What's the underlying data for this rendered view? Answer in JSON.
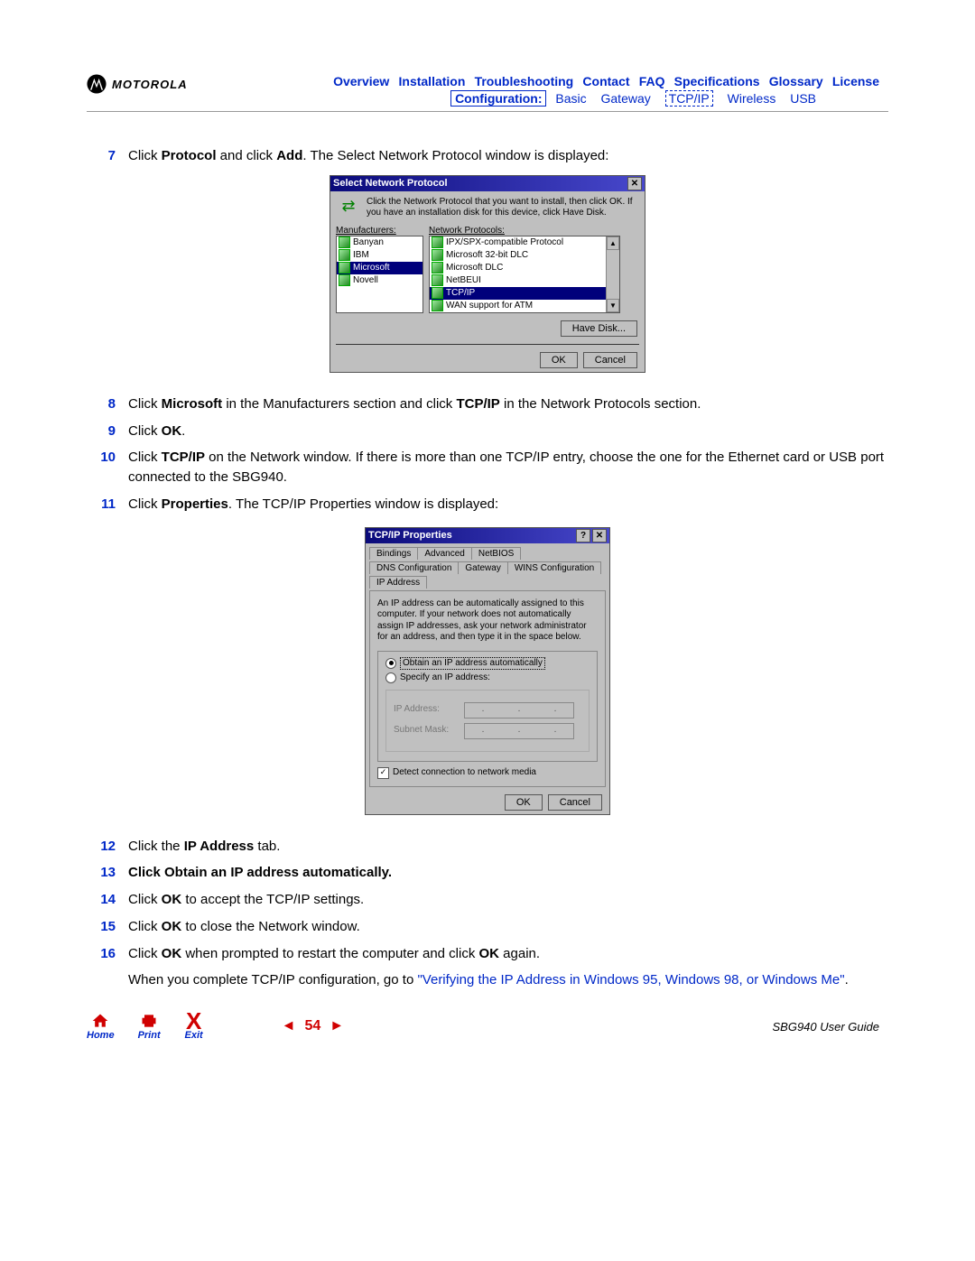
{
  "header": {
    "logo_text": "MOTOROLA",
    "nav1": [
      "Overview",
      "Installation",
      "Troubleshooting",
      "Contact",
      "FAQ",
      "Specifications",
      "Glossary",
      "License"
    ],
    "nav2_config": "Configuration:",
    "nav2_items": [
      "Basic",
      "Gateway",
      "TCP/IP",
      "Wireless",
      "USB"
    ]
  },
  "steps": {
    "s7": {
      "num": "7",
      "pre": "Click ",
      "b1": "Protocol",
      "mid": " and click ",
      "b2": "Add",
      "post": ". The Select Network Protocol window is displayed:"
    },
    "s8": {
      "num": "8",
      "pre": "Click ",
      "b1": "Microsoft",
      "mid": " in the Manufacturers section and click ",
      "b2": "TCP/IP",
      "post": " in the Network Protocols section."
    },
    "s9": {
      "num": "9",
      "pre": "Click ",
      "b1": "OK",
      "post": "."
    },
    "s10": {
      "num": "10",
      "pre": "Click ",
      "b1": "TCP/IP",
      "post": " on the Network window. If there is more than one TCP/IP entry, choose the one for the Ethernet card or USB port connected to the SBG940."
    },
    "s11": {
      "num": "11",
      "pre": "Click ",
      "b1": "Properties",
      "post": ". The TCP/IP Properties window is displayed:"
    },
    "s12": {
      "num": "12",
      "pre": "Click the ",
      "b1": "IP Address",
      "post": " tab."
    },
    "s13": {
      "num": "13",
      "text": "Click Obtain an IP address automatically."
    },
    "s14": {
      "num": "14",
      "pre": "Click ",
      "b1": "OK",
      "post": " to accept the TCP/IP settings."
    },
    "s15": {
      "num": "15",
      "pre": "Click ",
      "b1": "OK",
      "post": " to close the Network window."
    },
    "s16": {
      "num": "16",
      "pre": "Click ",
      "b1": "OK",
      "mid": " when prompted to restart the computer and click ",
      "b2": "OK",
      "post": " again."
    },
    "closing_pre": "When you complete TCP/IP configuration, go to ",
    "closing_link": "\"Verifying the IP Address in Windows 95, Windows 98, or Windows Me\"",
    "closing_post": "."
  },
  "dialog1": {
    "title": "Select Network Protocol",
    "info": "Click the Network Protocol that you want to install, then click OK. If you have an installation disk for this device, click Have Disk.",
    "manuf_label": "Manufacturers:",
    "proto_label": "Network Protocols:",
    "manufacturers": [
      "Banyan",
      "IBM",
      "Microsoft",
      "Novell"
    ],
    "manuf_selected": "Microsoft",
    "protocols": [
      "IPX/SPX-compatible Protocol",
      "Microsoft 32-bit DLC",
      "Microsoft DLC",
      "NetBEUI",
      "TCP/IP",
      "WAN support for ATM"
    ],
    "proto_selected": "TCP/IP",
    "have_disk": "Have Disk...",
    "ok": "OK",
    "cancel": "Cancel"
  },
  "dialog2": {
    "title": "TCP/IP Properties",
    "tabs_row1": [
      "Bindings",
      "Advanced",
      "NetBIOS"
    ],
    "tabs_row2": [
      "DNS Configuration",
      "Gateway",
      "WINS Configuration",
      "IP Address"
    ],
    "active_tab": "IP Address",
    "blurb": "An IP address can be automatically assigned to this computer. If your network does not automatically assign IP addresses, ask your network administrator for an address, and then type it in the space below.",
    "radio_auto": "Obtain an IP address automatically",
    "radio_specify": "Specify an IP address:",
    "ip_label": "IP Address:",
    "mask_label": "Subnet Mask:",
    "detect": "Detect connection to network media",
    "ok": "OK",
    "cancel": "Cancel"
  },
  "footer": {
    "home": "Home",
    "print": "Print",
    "exit": "Exit",
    "page": "54",
    "guide": "SBG940 User Guide"
  }
}
